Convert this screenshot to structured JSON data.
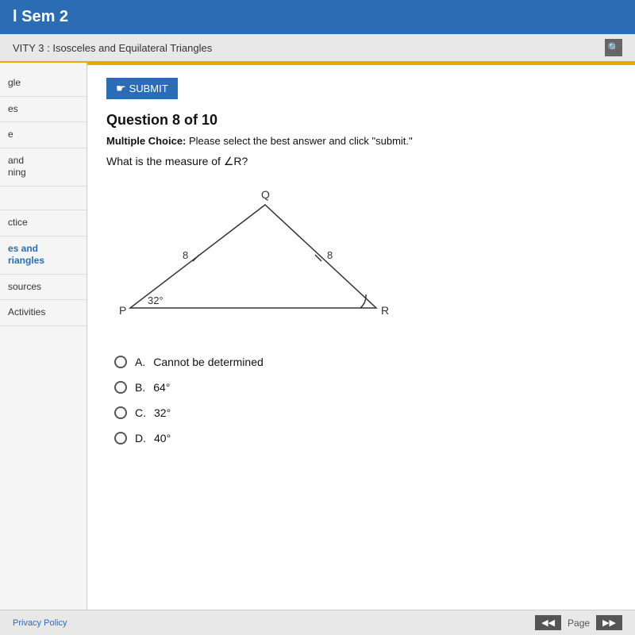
{
  "header": {
    "title": "l Sem 2"
  },
  "breadcrumb": {
    "text": "VITY 3 : Isosceles and Equilateral Triangles"
  },
  "sidebar": {
    "items": [
      {
        "label": "gle",
        "active": false
      },
      {
        "label": "es",
        "active": false
      },
      {
        "label": "e",
        "active": false
      },
      {
        "label": "and\nning",
        "active": false
      },
      {
        "label": "",
        "active": false
      },
      {
        "label": "ctice",
        "active": false
      },
      {
        "label": "es and\nriangles",
        "active": true
      },
      {
        "label": "sources",
        "active": false
      },
      {
        "label": "Activities",
        "active": false
      }
    ]
  },
  "question": {
    "title": "Question 8 of 10",
    "instruction_bold": "Multiple Choice:",
    "instruction_rest": " Please select the best answer and click \"submit.\"",
    "text": "What is the measure of ∠R?",
    "triangle": {
      "vertex_q": "Q",
      "vertex_p": "P",
      "vertex_r": "R",
      "left_side": "8",
      "right_side": "8",
      "angle_label": "32°"
    },
    "choices": [
      {
        "letter": "A.",
        "text": "Cannot be determined"
      },
      {
        "letter": "B.",
        "text": "64°"
      },
      {
        "letter": "C.",
        "text": "32°"
      },
      {
        "letter": "D.",
        "text": "40°"
      }
    ]
  },
  "submit_button": "SUBMIT",
  "bottom": {
    "privacy": "Privacy Policy",
    "page_label": "Page"
  }
}
